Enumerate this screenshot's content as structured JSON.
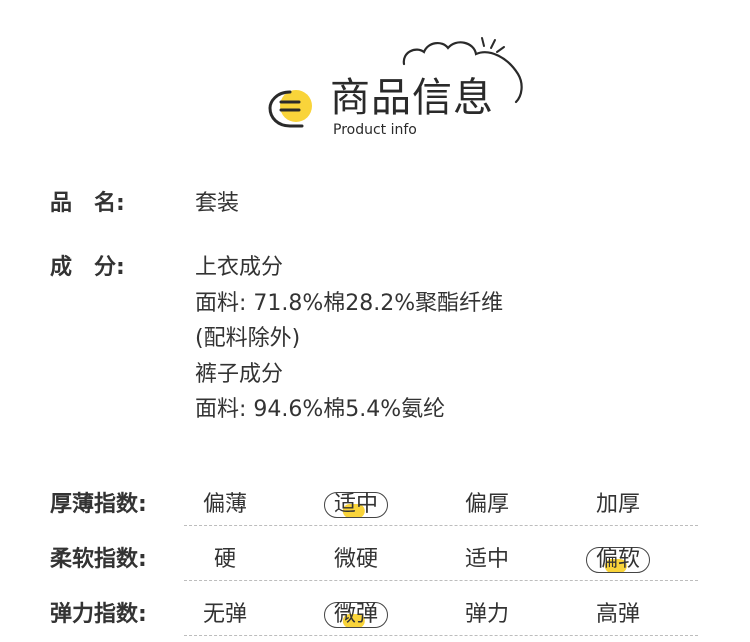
{
  "header": {
    "title": "商品信息",
    "subtitle": "Product info",
    "logo_icon": "menu-circle-icon",
    "decoration_icon": "cloud-icon",
    "accent_color": "#f9d43a"
  },
  "details": [
    {
      "label": "品　名:",
      "lines": [
        "套装"
      ]
    },
    {
      "label": "成　分:",
      "lines": [
        "上衣成分",
        "面料: 71.8%棉28.2%聚酯纤维",
        "(配料除外)",
        "裤子成分",
        "面料: 94.6%棉5.4%氨纶"
      ]
    }
  ],
  "scales": [
    {
      "label": "厚薄指数:",
      "options": [
        "偏薄",
        "适中",
        "偏厚",
        "加厚"
      ],
      "selected": "适中"
    },
    {
      "label": "柔软指数:",
      "options": [
        "硬",
        "微硬",
        "适中",
        "偏软"
      ],
      "selected": "偏软"
    },
    {
      "label": "弹力指数:",
      "options": [
        "无弹",
        "微弹",
        "弹力",
        "高弹"
      ],
      "selected": "微弹"
    }
  ]
}
